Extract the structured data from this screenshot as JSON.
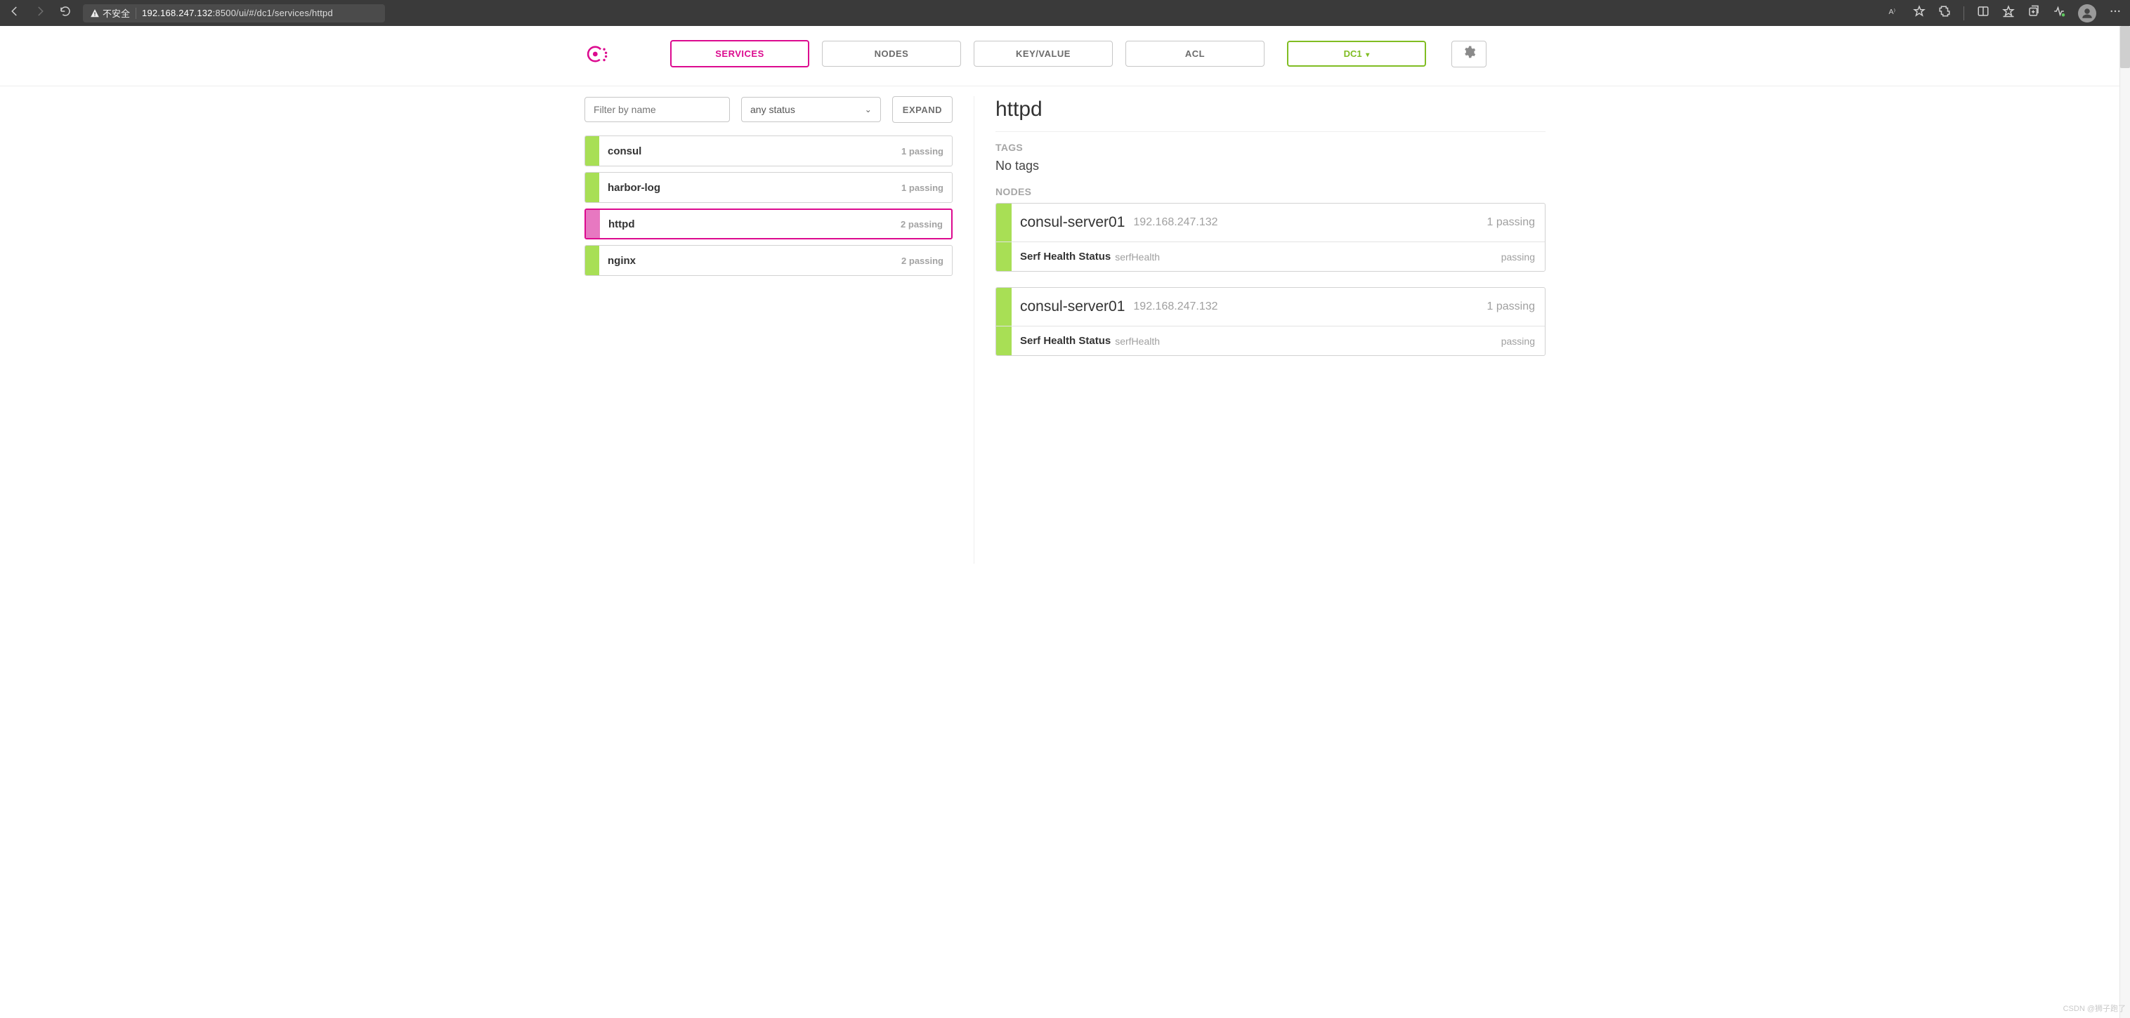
{
  "browser": {
    "insecure_label": "不安全",
    "url_host": "192.168.247.132",
    "url_rest": ":8500/ui/#/dc1/services/httpd"
  },
  "nav": {
    "services": "SERVICES",
    "nodes": "NODES",
    "kv": "KEY/VALUE",
    "acl": "ACL",
    "dc": "DC1",
    "dc_caret": "▾"
  },
  "filter": {
    "placeholder": "Filter by name",
    "status": "any status",
    "expand": "EXPAND"
  },
  "services": [
    {
      "name": "consul",
      "count": "1 passing",
      "active": false
    },
    {
      "name": "harbor-log",
      "count": "1 passing",
      "active": false
    },
    {
      "name": "httpd",
      "count": "2 passing",
      "active": true
    },
    {
      "name": "nginx",
      "count": "2 passing",
      "active": false
    }
  ],
  "detail": {
    "title": "httpd",
    "tags_label": "TAGS",
    "no_tags": "No tags",
    "nodes_label": "NODES",
    "nodes": [
      {
        "name": "consul-server01",
        "ip": "192.168.247.132",
        "passing": "1 passing",
        "check_name": "Serf Health Status",
        "check_id": "serfHealth",
        "check_status": "passing"
      },
      {
        "name": "consul-server01",
        "ip": "192.168.247.132",
        "passing": "1 passing",
        "check_name": "Serf Health Status",
        "check_id": "serfHealth",
        "check_status": "passing"
      }
    ]
  },
  "watermark": "CSDN @狮子跑了"
}
